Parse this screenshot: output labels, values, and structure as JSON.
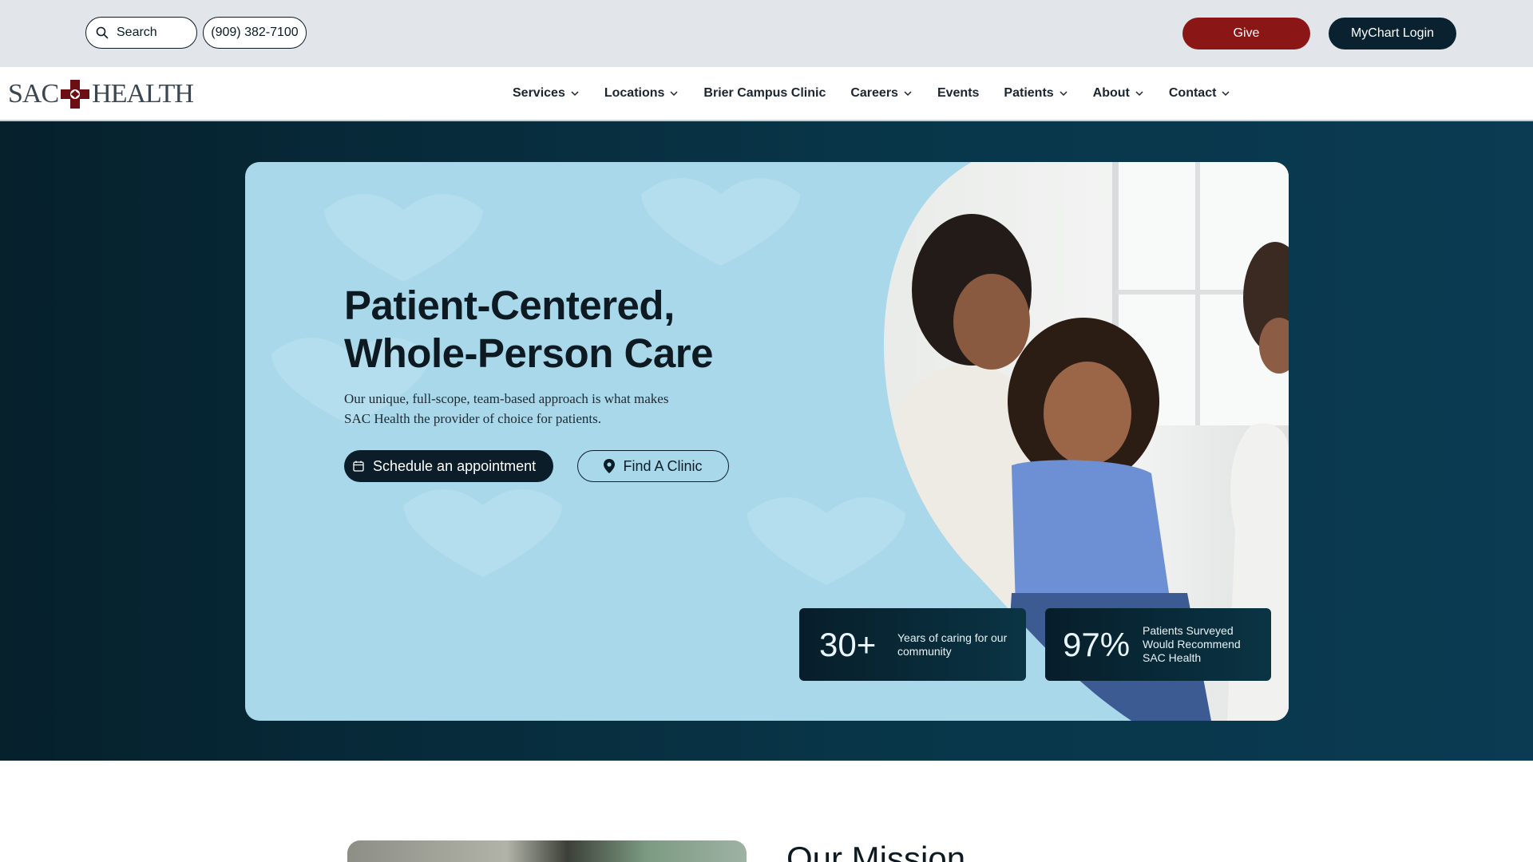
{
  "utility_bar": {
    "search_label": "Search",
    "phone": "(909) 382-7100",
    "give_label": "Give",
    "mychart_label": "MyChart Login",
    "colors": {
      "background": "#e2e6ea",
      "give": "#8b1616",
      "mychart": "#0a2230"
    }
  },
  "logo": {
    "left_text": "SAC",
    "right_text": "HEALTH"
  },
  "nav": {
    "items": [
      {
        "label": "Services",
        "icon": "chevron-down-icon"
      },
      {
        "label": "Locations",
        "icon": "chevron-down-icon"
      },
      {
        "label": "Brier Campus Clinic",
        "icon": ""
      },
      {
        "label": "Careers",
        "icon": "chevron-down-icon"
      },
      {
        "label": "Events",
        "icon": ""
      },
      {
        "label": "Patients",
        "icon": "chevron-down-icon"
      },
      {
        "label": "About",
        "icon": "chevron-down-icon"
      },
      {
        "label": "Contact",
        "icon": "chevron-down-icon"
      }
    ]
  },
  "hero": {
    "title_line1": "Patient-Centered,",
    "title_line2": "Whole-Person Care",
    "subtitle": "Our unique, full-scope, team-based approach is what makes SAC Health the provider of choice for patients.",
    "schedule_label": "Schedule an appointment",
    "find_clinic_label": "Find A Clinic",
    "colors": {
      "section_bg": "#06202c",
      "card_bg": "#a9d8ea"
    },
    "stats": [
      {
        "number": "30+",
        "label": "Years of caring for our community"
      },
      {
        "number": "97%",
        "label": "Patients Surveyed Would Recommend SAC Health"
      }
    ]
  },
  "mission": {
    "title": "Our Mission"
  }
}
